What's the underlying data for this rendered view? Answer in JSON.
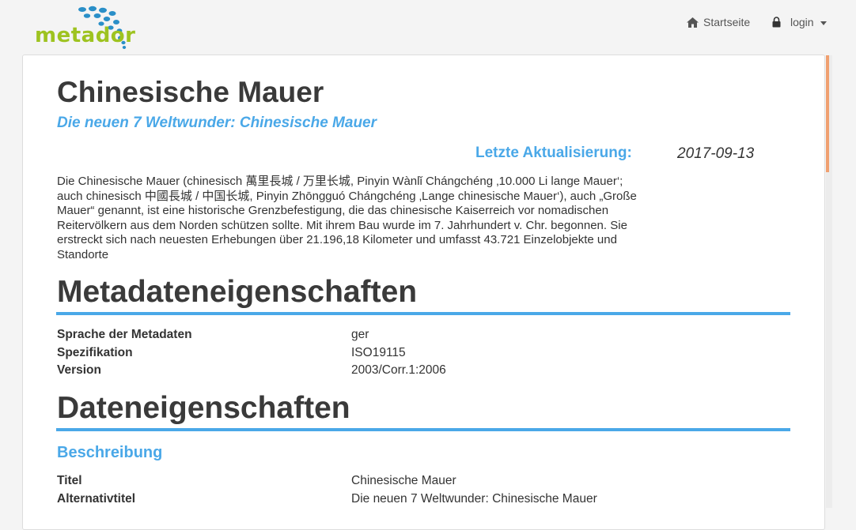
{
  "logo": {
    "text": "metador"
  },
  "nav": {
    "home_label": "Startseite",
    "login_label": "login"
  },
  "record": {
    "title": "Chinesische Mauer",
    "subtitle": "Die neuen 7 Weltwunder: Chinesische Mauer",
    "update_label": "Letzte Aktualisierung:",
    "update_value": "2017-09-13",
    "description": "Die Chinesische Mauer (chinesisch 萬里長城 / 万里长城, Pinyin Wànlǐ Chángchéng ‚10.000 Li lange Mauer‘; auch chinesisch 中國長城 / 中国长城, Pinyin Zhōngguó Chángchéng ‚Lange chinesische Mauer‘), auch „Große Mauer“ genannt, ist eine historische Grenzbefestigung, die das chinesische Kaiserreich vor nomadischen Reitervölkern aus dem Norden schützen sollte. Mit ihrem Bau wurde im 7. Jahrhundert v. Chr. begonnen. Sie erstreckt sich nach neuesten Erhebungen über 21.196,18 Kilometer und umfasst 43.721 Einzelobjekte und Standorte"
  },
  "metadata_section": {
    "heading": "Metadateneigenschaften",
    "rows": [
      {
        "key": "Sprache der Metadaten",
        "value": "ger"
      },
      {
        "key": "Spezifikation",
        "value": "ISO19115"
      },
      {
        "key": "Version",
        "value": "2003/Corr.1:2006"
      }
    ]
  },
  "data_section": {
    "heading": "Dateneigenschaften",
    "subheading": "Beschreibung",
    "rows": [
      {
        "key": "Titel",
        "value": "Chinesische Mauer"
      },
      {
        "key": "Alternativtitel",
        "value": "Die neuen 7 Weltwunder: Chinesische Mauer"
      }
    ]
  },
  "colors": {
    "accent": "#4aa8e8",
    "logo_green": "#9ec320",
    "logo_blue": "#2a8fc8",
    "scroll_thumb": "#f0a070"
  },
  "icons": {
    "home": "home-icon",
    "lock": "lock-icon",
    "caret": "caret-down-icon"
  }
}
